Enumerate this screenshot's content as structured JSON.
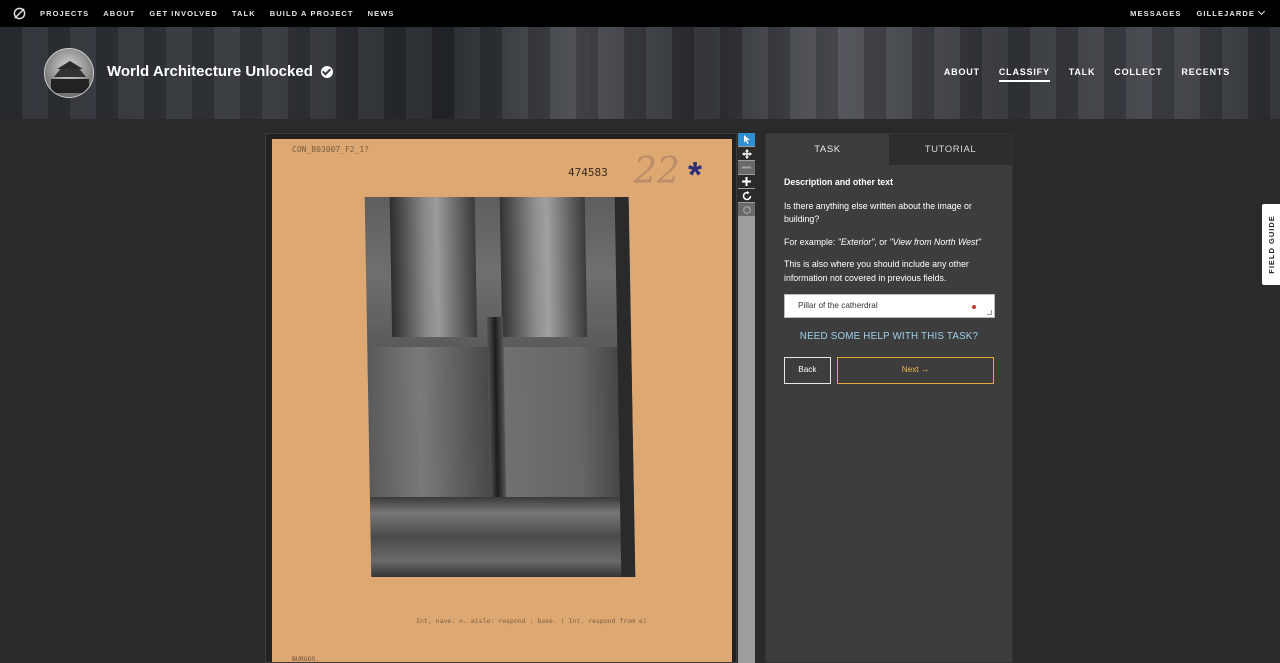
{
  "topnav": {
    "links": [
      "PROJECTS",
      "ABOUT",
      "GET INVOLVED",
      "TALK",
      "BUILD A PROJECT",
      "NEWS"
    ],
    "messages": "MESSAGES",
    "user": "GILLEJARDE"
  },
  "project": {
    "title": "World Architecture Unlocked",
    "nav": [
      "ABOUT",
      "CLASSIFY",
      "TALK",
      "COLLECT",
      "RECENTS"
    ],
    "active_nav": "CLASSIFY"
  },
  "subject": {
    "ref": "CON_B03007_F2_1?",
    "number": "474583",
    "handwritten": "22",
    "caption": "Int, nave: n. aisle: respond : base.  ( Int. respond from e)",
    "footer": "BURGOS."
  },
  "tools": [
    "pointer-icon",
    "move-icon",
    "zoom-out-icon",
    "zoom-in-icon",
    "rotate-icon",
    "reset-icon"
  ],
  "task": {
    "tabs": [
      "TASK",
      "TUTORIAL"
    ],
    "question": "Description and other text",
    "line1": "Is there anything else written about the image or building?",
    "example_prefix": "For example: ",
    "example_a": "\"Exterior\"",
    "example_mid": ", or ",
    "example_b": "\"View from North West\"",
    "line3": "This is also where you should include any other information not covered in previous fields.",
    "answer_value": "Pillar of the catherdral",
    "help": "NEED SOME HELP WITH THIS TASK?",
    "back": "Back",
    "next": "Next →"
  },
  "field_guide": "FIELD GUIDE"
}
